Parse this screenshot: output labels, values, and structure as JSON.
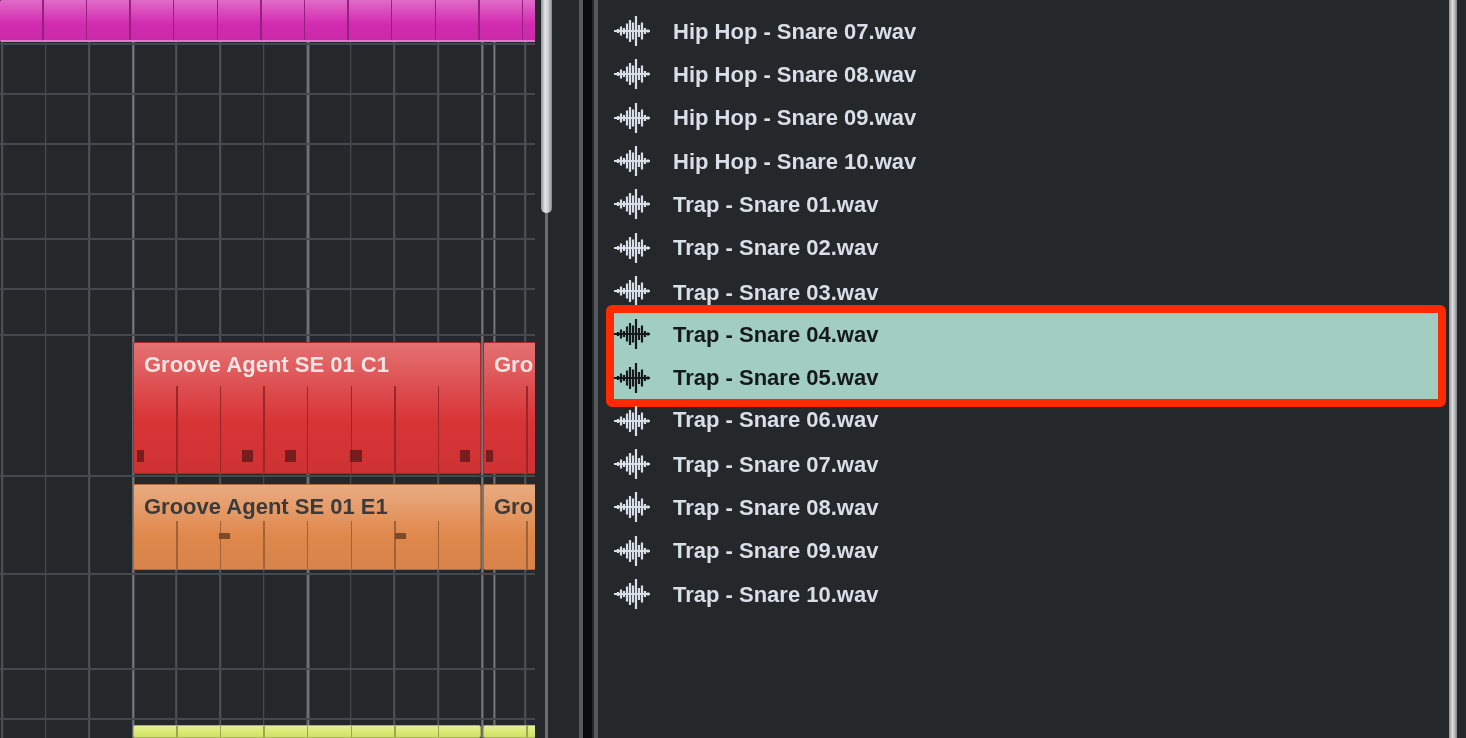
{
  "arrange": {
    "tracks": [
      {
        "clips": [
          {
            "color": "#d22bb0"
          }
        ]
      },
      {
        "clips": [
          {
            "color": "#d83436",
            "label": "Groove Agent SE 01 C1"
          },
          {
            "color": "#d83436",
            "label": "Gro"
          }
        ]
      },
      {
        "clips": [
          {
            "color": "#e0884c",
            "label": "Groove Agent SE 01 E1"
          },
          {
            "color": "#e0884c",
            "label": "Gro"
          }
        ]
      },
      {
        "clips": [
          {
            "color": "#d9e86e"
          },
          {
            "color": "#d9e86e"
          }
        ]
      }
    ]
  },
  "browser": {
    "files": [
      {
        "name": "Hip Hop - Snare 07.wav",
        "selected": false,
        "framed": false
      },
      {
        "name": "Hip Hop - Snare 08.wav",
        "selected": false,
        "framed": false
      },
      {
        "name": "Hip Hop - Snare 09.wav",
        "selected": false,
        "framed": false
      },
      {
        "name": "Hip Hop - Snare 10.wav",
        "selected": false,
        "framed": false
      },
      {
        "name": "Trap - Snare 01.wav",
        "selected": false,
        "framed": false
      },
      {
        "name": "Trap - Snare 02.wav",
        "selected": false,
        "framed": false
      },
      {
        "name": "Trap - Snare 03.wav",
        "selected": false,
        "framed": false
      },
      {
        "name": "Trap - Snare 04.wav",
        "selected": true,
        "framed": true
      },
      {
        "name": "Trap - Snare 05.wav",
        "selected": true,
        "framed": true
      },
      {
        "name": "Trap - Snare 06.wav",
        "selected": false,
        "framed": false
      },
      {
        "name": "Trap - Snare 07.wav",
        "selected": false,
        "framed": false
      },
      {
        "name": "Trap - Snare 08.wav",
        "selected": false,
        "framed": false
      },
      {
        "name": "Trap - Snare 09.wav",
        "selected": false,
        "framed": false
      },
      {
        "name": "Trap - Snare 10.wav",
        "selected": false,
        "framed": false
      }
    ]
  }
}
